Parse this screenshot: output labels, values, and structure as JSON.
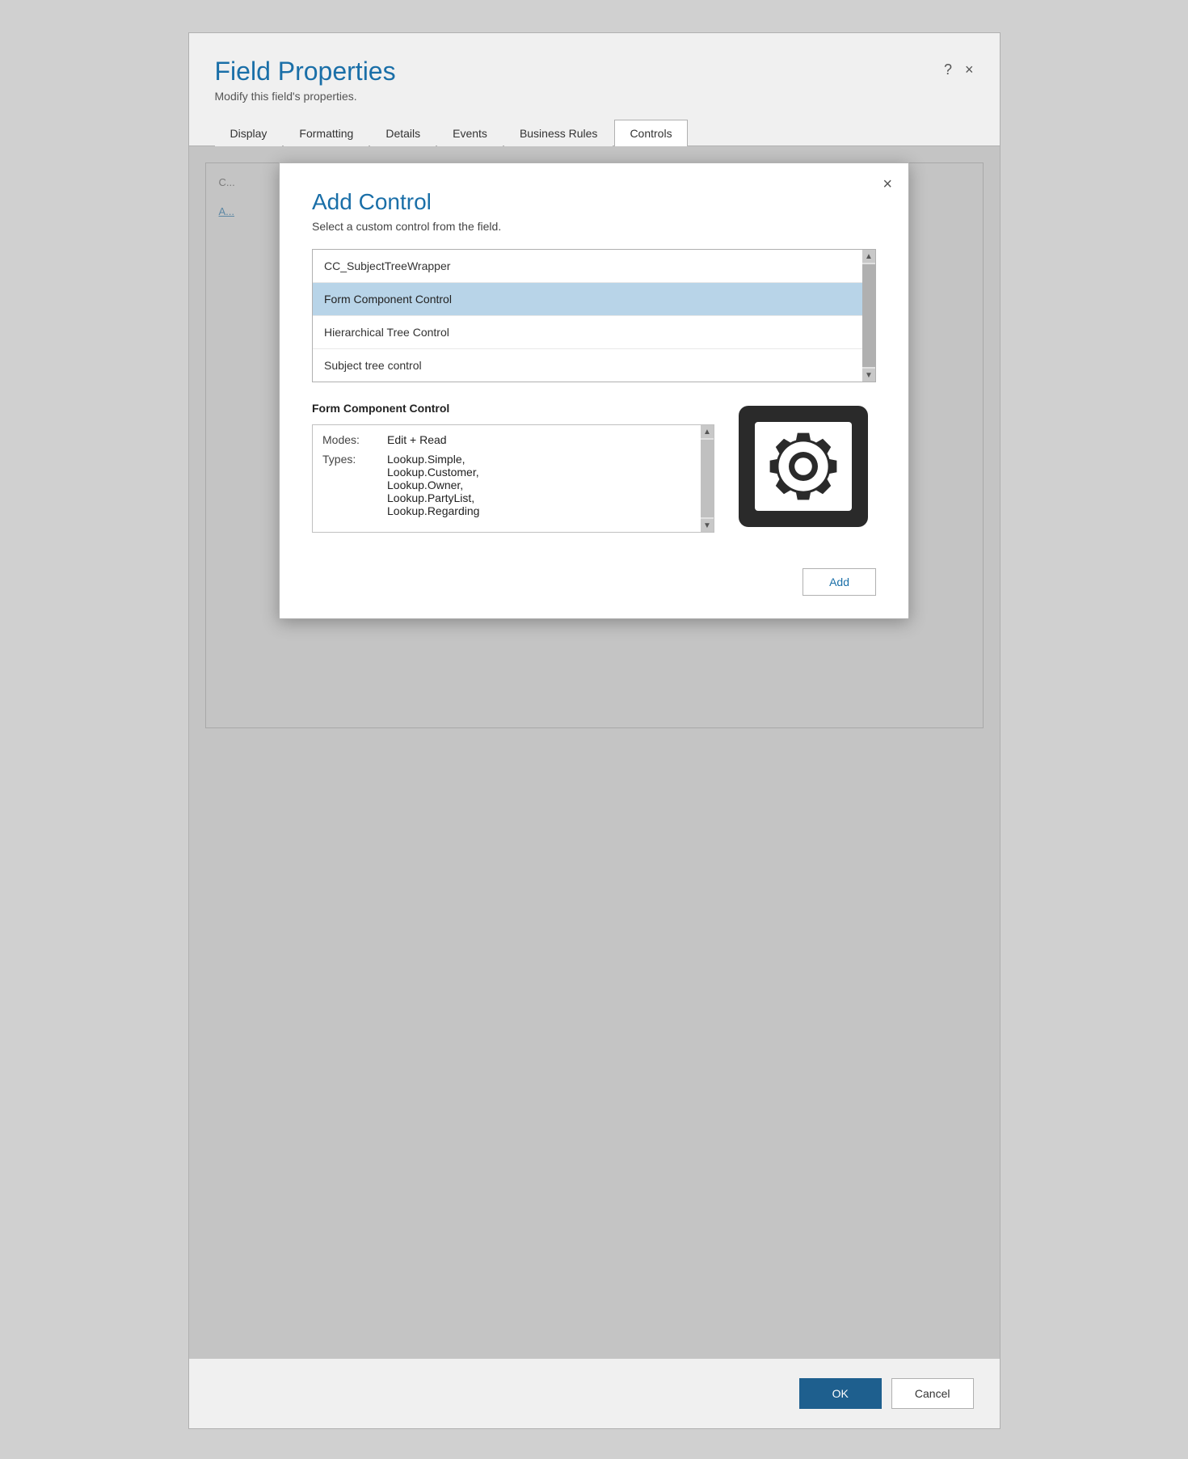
{
  "window": {
    "title": "Field Properties",
    "subtitle": "Modify this field's properties.",
    "help_btn": "?",
    "close_btn": "×"
  },
  "tabs": [
    {
      "id": "display",
      "label": "Display",
      "active": false
    },
    {
      "id": "formatting",
      "label": "Formatting",
      "active": false
    },
    {
      "id": "details",
      "label": "Details",
      "active": false
    },
    {
      "id": "events",
      "label": "Events",
      "active": false
    },
    {
      "id": "business-rules",
      "label": "Business Rules",
      "active": false
    },
    {
      "id": "controls",
      "label": "Controls",
      "active": true
    }
  ],
  "modal": {
    "title": "Add Control",
    "description": "Select a custom control from the field.",
    "close_btn": "×",
    "list_items": [
      {
        "id": "cc-subject",
        "label": "CC_SubjectTreeWrapper",
        "selected": false
      },
      {
        "id": "form-component",
        "label": "Form Component Control",
        "selected": true
      },
      {
        "id": "hierarchical",
        "label": "Hierarchical Tree Control",
        "selected": false
      },
      {
        "id": "subject-tree",
        "label": "Subject tree control",
        "selected": false
      }
    ],
    "detail": {
      "title": "Form Component Control",
      "modes_label": "Modes:",
      "modes_value": "Edit + Read",
      "types_label": "Types:",
      "types_value": "Lookup.Simple,\nLookup.Customer,\nLookup.Owner,\nLookup.PartyList,\nLookup.Regarding"
    },
    "add_btn": "Add"
  },
  "bottom": {
    "ok_btn": "OK",
    "cancel_btn": "Cancel"
  }
}
